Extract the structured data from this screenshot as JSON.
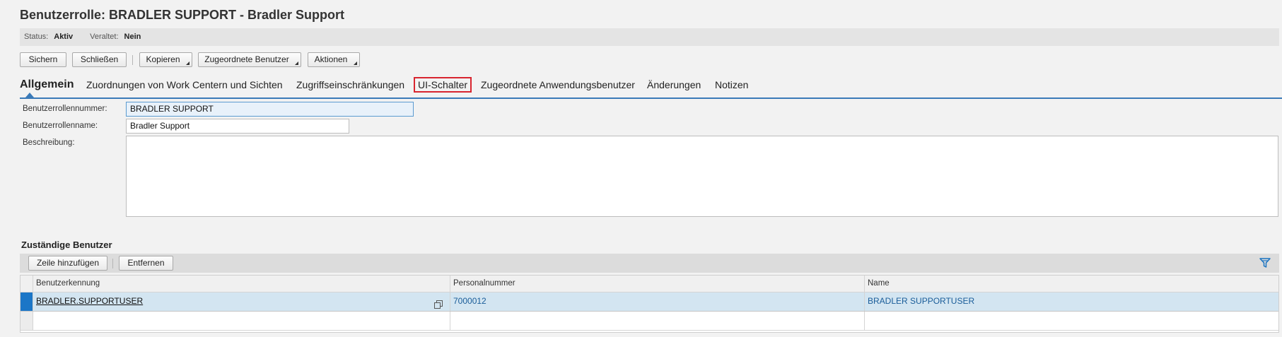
{
  "header": {
    "title": "Benutzerrolle: BRADLER SUPPORT - Bradler Support"
  },
  "status": {
    "status_label": "Status:",
    "status_value": "Aktiv",
    "obsolete_label": "Veraltet:",
    "obsolete_value": "Nein"
  },
  "toolbar": {
    "save": "Sichern",
    "close": "Schließen",
    "copy": "Kopieren",
    "assigned_users": "Zugeordnete Benutzer",
    "actions": "Aktionen"
  },
  "tabs": [
    {
      "label": "Allgemein",
      "active": true
    },
    {
      "label": "Zuordnungen von Work Centern und Sichten"
    },
    {
      "label": "Zugriffseinschränkungen"
    },
    {
      "label": "UI-Schalter",
      "highlighted": true
    },
    {
      "label": "Zugeordnete Anwendungsbenutzer"
    },
    {
      "label": "Änderungen"
    },
    {
      "label": "Notizen"
    }
  ],
  "form": {
    "number_label": "Benutzerrollennummer:",
    "number_value": "BRADLER SUPPORT",
    "name_label": "Benutzerrollenname:",
    "name_value": "Bradler Support",
    "description_label": "Beschreibung:",
    "description_value": ""
  },
  "responsible": {
    "title": "Zuständige Benutzer",
    "add_row": "Zeile hinzufügen",
    "remove": "Entfernen",
    "columns": [
      "Benutzerkennung",
      "Personalnummer",
      "Name"
    ],
    "rows": [
      [
        "BRADLER.SUPPORTUSER",
        "7000012",
        "BRADLER SUPPORTUSER"
      ]
    ]
  },
  "icons": {
    "filter": "filter-icon",
    "copy": "copy-icon",
    "accent": "#3a7ab8",
    "highlight": "#d8252f"
  }
}
